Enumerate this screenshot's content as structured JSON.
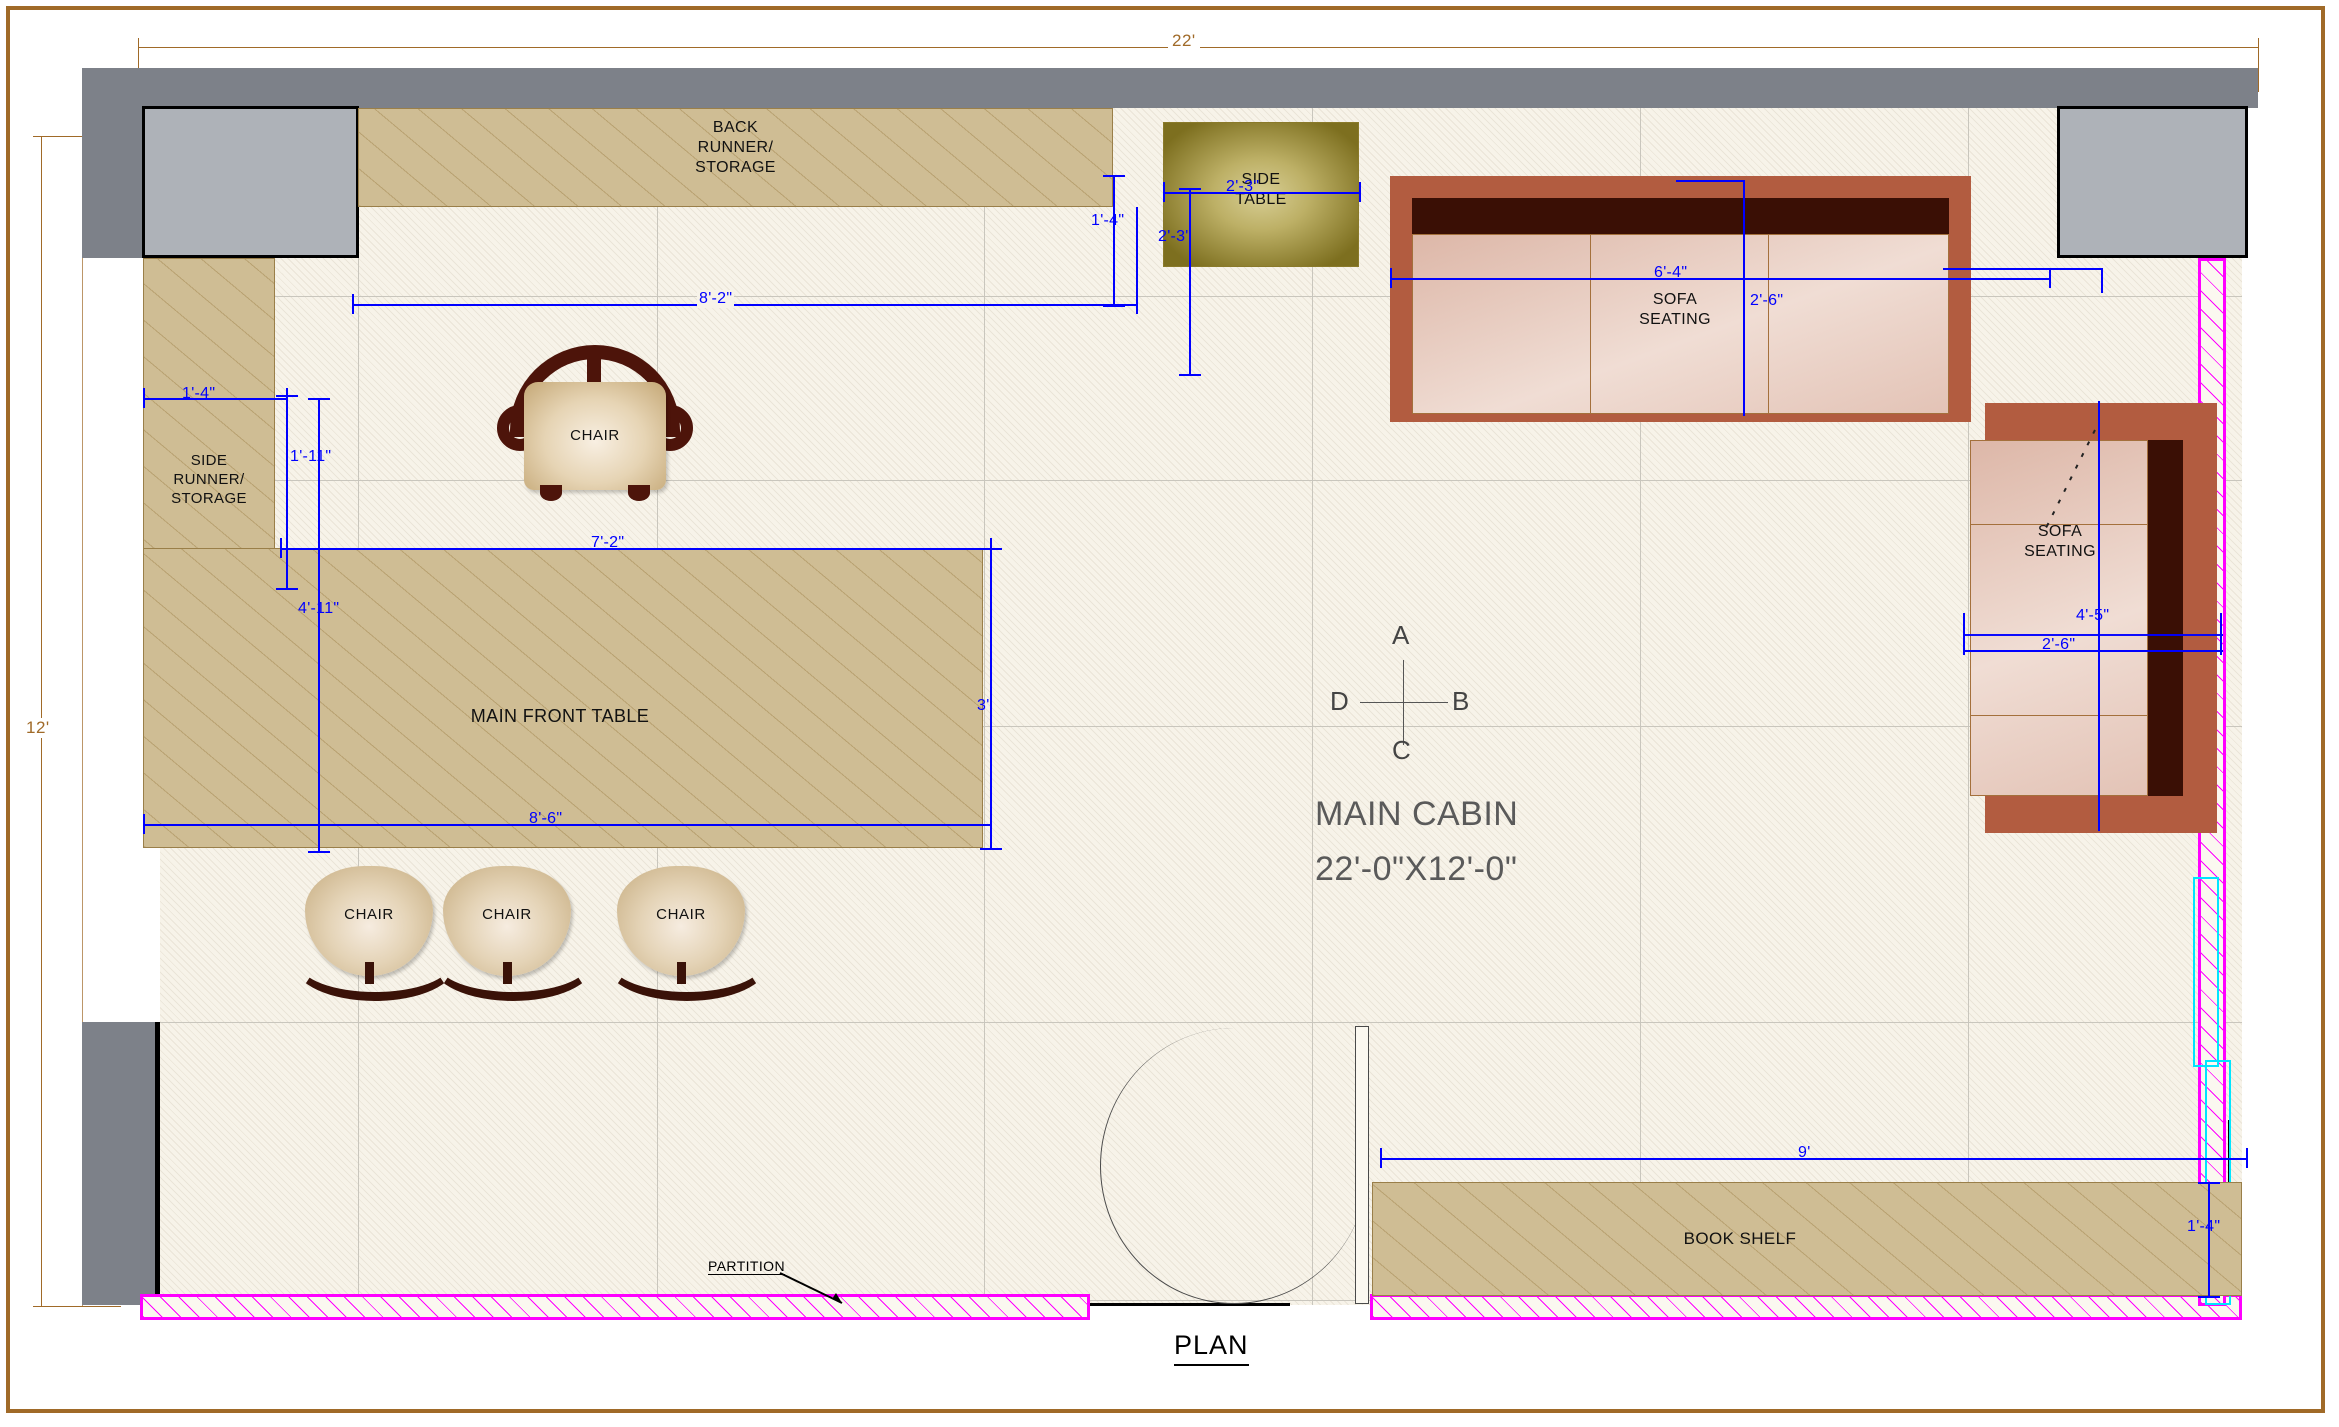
{
  "sheet": {
    "plan_label": "PLAN",
    "room_title": "MAIN CABIN",
    "room_size": "22'-0\"X12'-0\"",
    "overall_width_label": "22'",
    "overall_height_label": "12'",
    "partition_callout": "PARTITION",
    "colors": {
      "sheet_border": "#a06a28",
      "dimension_blue": "#0000ff",
      "dimension_brown": "#a06a28",
      "partition_magenta": "#ff00ff",
      "glass_cyan": "#00e5ff",
      "wall_gray": "#7d8189",
      "window_gray": "#aeb2b8",
      "wood_tan": "#cfbd94",
      "sofa_frame": "#b25c40",
      "sofa_cushion": "#e8cfc3",
      "sofa_back": "#3a0f05",
      "side_table": "#7d6f1f",
      "floor": "#f7f3e9",
      "text_gray": "#5a5a5a"
    }
  },
  "compass": {
    "a": "A",
    "b": "B",
    "c": "C",
    "d": "D"
  },
  "furniture": {
    "back_runner": {
      "label": "BACK\nRUNNER/\nSTORAGE",
      "l1": "BACK",
      "l2": "RUNNER/",
      "l3": "STORAGE"
    },
    "side_runner": {
      "l1": "SIDE",
      "l2": "RUNNER/",
      "l3": "STORAGE"
    },
    "main_front_table": {
      "label": "MAIN FRONT TABLE"
    },
    "side_table": {
      "l1": "SIDE",
      "l2": "TABLE"
    },
    "sofa_top": {
      "l1": "SOFA",
      "l2": "SEATING"
    },
    "sofa_right": {
      "l1": "SOFA",
      "l2": "SEATING"
    },
    "book_shelf": {
      "label": "BOOK SHELF"
    },
    "chair_top": {
      "label": "CHAIR"
    },
    "chair_1": {
      "label": "CHAIR"
    },
    "chair_2": {
      "label": "CHAIR"
    },
    "chair_3": {
      "label": "CHAIR"
    }
  },
  "dimensions": {
    "back_runner_width": "8'-2\"",
    "back_runner_depth": "1'-4\"",
    "side_runner_width": "1'-4\"",
    "side_runner_offset": "1'-11\"",
    "main_table_top": "7'-2\"",
    "main_table_bottom": "8'-6\"",
    "main_table_left": "4'-11\"",
    "main_table_right": "3'",
    "side_table_width": "2'-3\"",
    "side_table_depth": "2'-3\"",
    "sofa_top_width": "6'-4\"",
    "sofa_top_depth": "2'-6\"",
    "sofa_right_length": "4'-5\"",
    "sofa_right_depth": "2'-6\"",
    "book_shelf_width": "9'",
    "book_shelf_depth": "1'-4\""
  }
}
